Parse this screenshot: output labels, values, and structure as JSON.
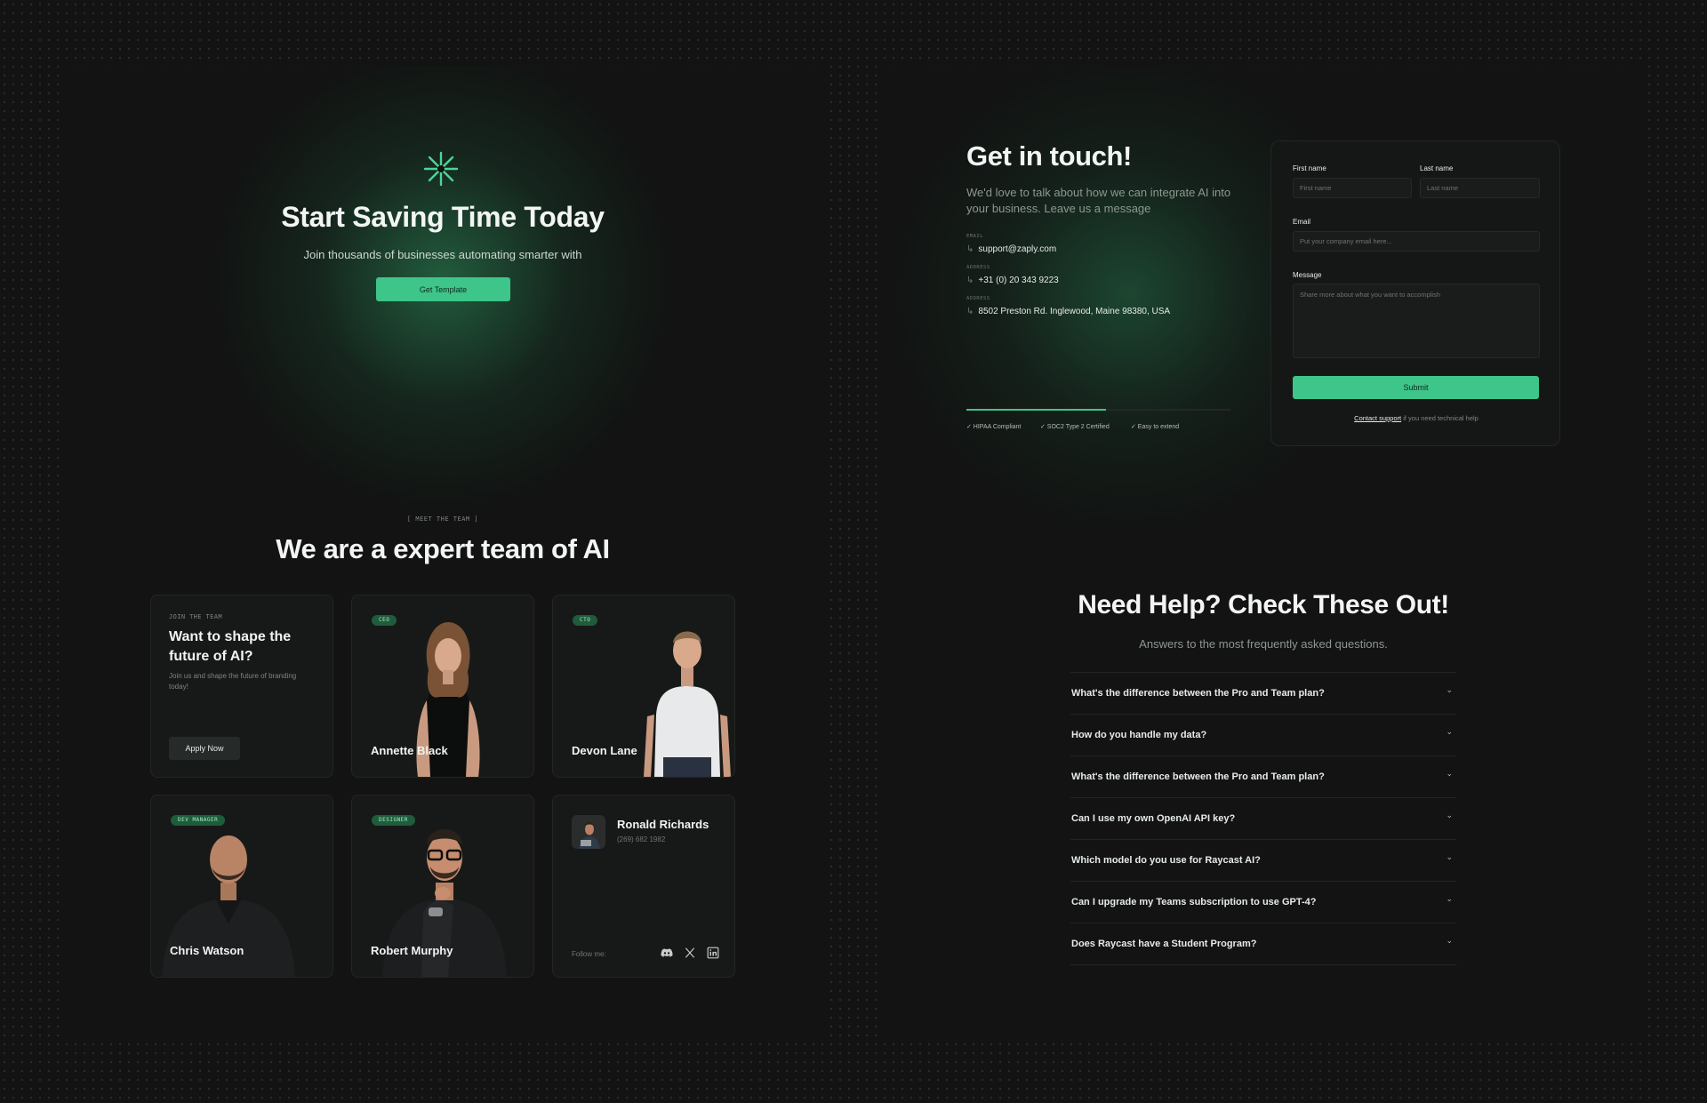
{
  "colors": {
    "accent": "#3ec58a",
    "background": "#121312",
    "card": "#171918",
    "badge": "#1f5c3c"
  },
  "hero": {
    "icon": "asterisk-icon",
    "title": "Start Saving Time Today",
    "subtitle": "Join thousands of businesses automating smarter with",
    "button_label": "Get Template"
  },
  "team": {
    "eyebrow": "[  MEET THE TEAM  ]",
    "title": "We are a expert team of AI",
    "join_card": {
      "eyebrow": "JOIN THE TEAM",
      "title": "Want to shape the future of AI?",
      "subtitle": "Join us and shape the future of branding today!",
      "button_label": "Apply Now"
    },
    "members": [
      {
        "badge": "CEO",
        "name": "Annette Black"
      },
      {
        "badge": "CTO",
        "name": "Devon Lane"
      },
      {
        "badge": "DEV MANAGER",
        "name": "Chris Watson"
      },
      {
        "badge": "DESIGNER",
        "name": "Robert Murphy"
      }
    ],
    "contact_card": {
      "name": "Ronald Richards",
      "phone": "(269) 682 1982",
      "follow_label": "Follow me:",
      "socials": [
        "discord-icon",
        "x-icon",
        "linkedin-icon"
      ]
    }
  },
  "contact": {
    "title": "Get in touch!",
    "subtitle": "We'd love to talk about how we can integrate AI into your business. Leave us a message",
    "info": [
      {
        "label": "EMAIL",
        "value": "support@zaply.com"
      },
      {
        "label": "ADDRESS",
        "value": "+31 (0) 20 343 9223"
      },
      {
        "label": "ADDRESS",
        "value": "8502 Preston Rd. Inglewood, Maine 98380, USA"
      }
    ],
    "progress": 0.53,
    "compliance": [
      "✓ HIPAA Compliant",
      "✓ SOC2 Type 2 Certified",
      "✓ Easy to extend"
    ],
    "form": {
      "first_name_label": "First name",
      "first_name_placeholder": "First name",
      "last_name_label": "Last name",
      "last_name_placeholder": "Last name",
      "email_label": "Email",
      "email_placeholder": "Put your company email here...",
      "message_label": "Message",
      "message_placeholder": "Share more about what you want to accomplish",
      "submit_label": "Submit",
      "support_link": "Contact support",
      "support_text": " if you need technical help"
    }
  },
  "faq": {
    "title": "Need Help? Check These Out!",
    "subtitle": "Answers to the most frequently asked questions.",
    "items": [
      "What's the difference between the Pro and Team plan?",
      "How do you handle my data?",
      "What's the difference between the Pro and Team plan?",
      "Can I use my own OpenAI API key?",
      "Which model do you use for Raycast AI?",
      "Can I upgrade my Teams subscription to use GPT-4?",
      "Does Raycast have a Student Program?"
    ]
  }
}
